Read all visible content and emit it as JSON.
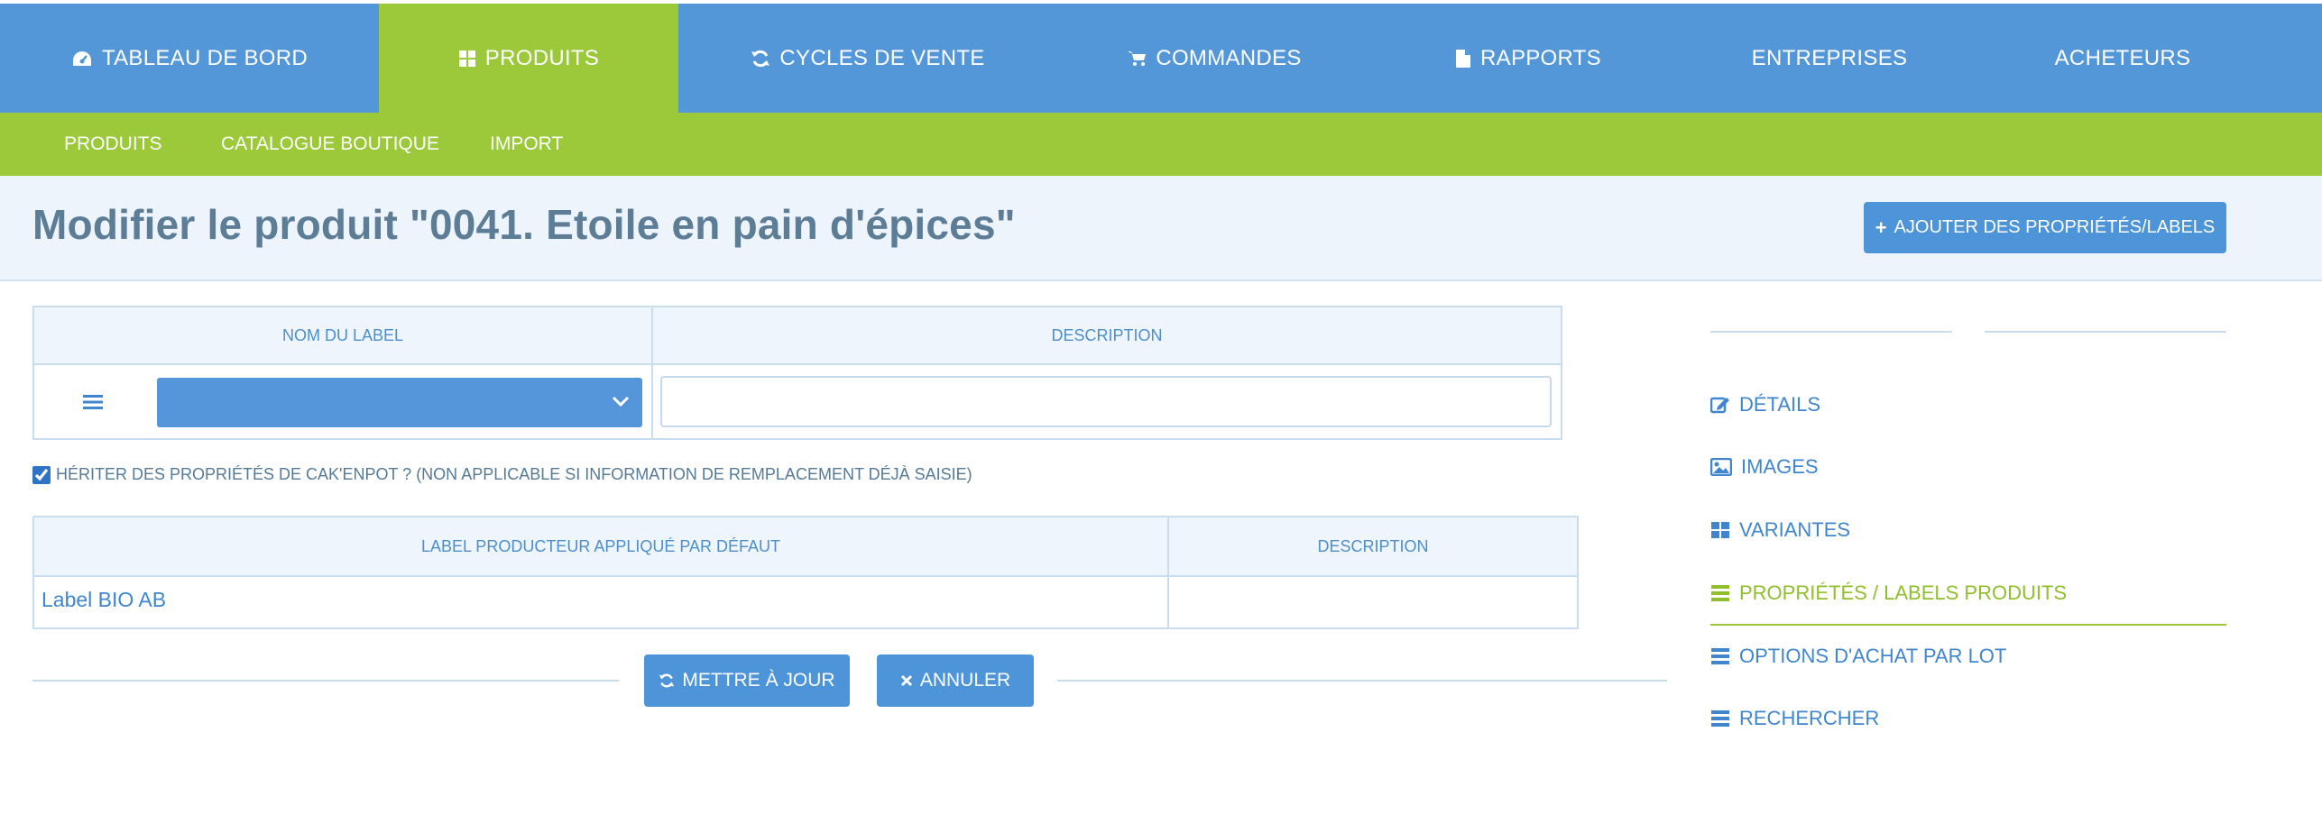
{
  "top_nav": {
    "items": [
      {
        "label": "TABLEAU DE BORD",
        "icon": "dashboard-icon"
      },
      {
        "label": "PRODUITS",
        "icon": "grid-icon",
        "active": true
      },
      {
        "label": "CYCLES DE VENTE",
        "icon": "refresh-icon"
      },
      {
        "label": "COMMANDES",
        "icon": "cart-icon"
      },
      {
        "label": "RAPPORTS",
        "icon": "file-icon"
      },
      {
        "label": "ENTREPRISES"
      },
      {
        "label": "ACHETEURS"
      }
    ]
  },
  "sub_nav": {
    "items": [
      {
        "label": "PRODUITS",
        "active": true
      },
      {
        "label": "CATALOGUE BOUTIQUE"
      },
      {
        "label": "IMPORT"
      }
    ]
  },
  "page": {
    "title": "Modifier le produit \"0041. Etoile en pain d'épices\"",
    "add_button_label": "AJOUTER DES PROPRIÉTÉS/LABELS"
  },
  "labels_table": {
    "headers": [
      "NOM DU LABEL",
      "DESCRIPTION"
    ],
    "row": {
      "selected_label": "",
      "description": ""
    }
  },
  "inherit": {
    "checked": true,
    "label": "HÉRITER DES PROPRIÉTÉS DE CAK'ENPOT ? (NON APPLICABLE SI INFORMATION DE REMPLACEMENT DÉJÀ SAISIE)"
  },
  "default_table": {
    "headers": [
      "LABEL PRODUCTEUR APPLIQUÉ PAR DÉFAUT",
      "DESCRIPTION"
    ],
    "rows": [
      [
        "Label BIO AB",
        ""
      ]
    ]
  },
  "actions": {
    "update_label": "METTRE À JOUR",
    "cancel_label": "ANNULER"
  },
  "side_menu": {
    "items": [
      {
        "label": "DÉTAILS",
        "icon": "edit-icon"
      },
      {
        "label": "IMAGES",
        "icon": "image-icon"
      },
      {
        "label": "VARIANTES",
        "icon": "grid-icon"
      },
      {
        "label": "PROPRIÉTÉS / LABELS PRODUITS",
        "icon": "list-icon",
        "active": true
      },
      {
        "label": "OPTIONS D'ACHAT PAR LOT",
        "icon": "list-icon"
      },
      {
        "label": "RECHERCHER",
        "icon": "list-icon"
      }
    ]
  },
  "colors": {
    "nav_blue": "#5497d9",
    "accent_green": "#9cc93a",
    "link_blue": "#3f86cf",
    "title_gray": "#5d7d96"
  }
}
